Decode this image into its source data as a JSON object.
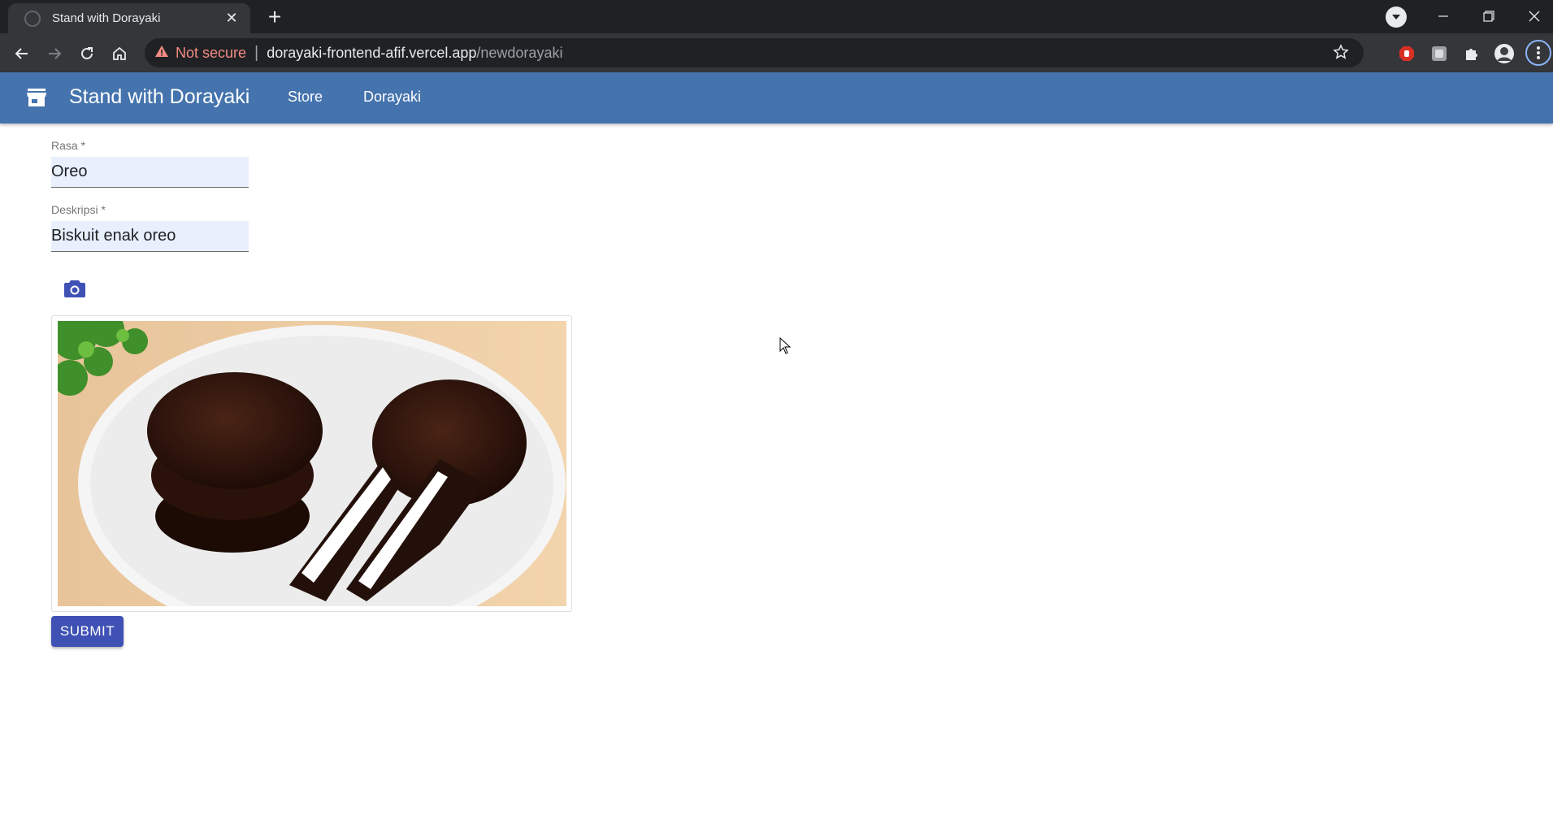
{
  "browser": {
    "tab_title": "Stand with Dorayaki",
    "tab_close": "✕",
    "new_tab": "+",
    "security_label": "Not secure",
    "separator": "|",
    "url_host": "dorayaki-frontend-afif.vercel.app",
    "url_path": "/newdorayaki"
  },
  "appbar": {
    "brand": "Stand with Dorayaki",
    "nav": [
      {
        "label": "Store"
      },
      {
        "label": "Dorayaki"
      }
    ],
    "color": "#4473ad"
  },
  "form": {
    "rasa": {
      "label": "Rasa *",
      "value": "Oreo"
    },
    "deskripsi": {
      "label": "Deskripsi *",
      "value": "Biskuit enak oreo"
    },
    "submit_label": "SUBMIT",
    "submit_color": "#3f51b5",
    "upload_icon": "camera-icon"
  }
}
